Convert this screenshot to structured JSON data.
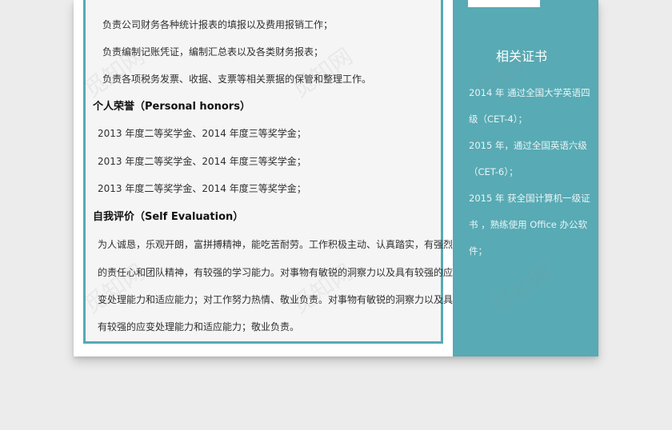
{
  "work_items": [
    "负责公司财务各种统计报表的填报以及费用报销工作；",
    "负责编制记账凭证，编制汇总表以及各类财务报表；",
    "负责各项税务发票、收据、支票等相关票据的保管和整理工作。"
  ],
  "honors": {
    "heading": "个人荣誉（Personal honors）",
    "items": [
      "2013 年度二等奖学金、2014 年度三等奖学金；",
      "2013 年度二等奖学金、2014 年度三等奖学金；",
      "2013 年度二等奖学金、2014 年度三等奖学金；"
    ]
  },
  "evaluation": {
    "heading": "自我评价（Self Evaluation）",
    "lines": [
      "为人诚恳，乐观开朗，富拼搏精神，能吃苦耐劳。工作积极主动、认真踏实，有强烈",
      "的责任心和团队精神，有较强的学习能力。对事物有敏锐的洞察力以及具有较强的应",
      "变处理能力和适应能力；对工作努力热情、敬业负责。对事物有敏锐的洞察力以及具",
      "有较强的应变处理能力和适应能力；敬业负责。"
    ]
  },
  "certificates": {
    "title": "相关证书",
    "lines": [
      "2014 年  通过全国大学英语四",
      "级（CET-4）；",
      "2015  年，通过全国英语六级",
      "（CET-6）；",
      "2015 年  获全国计算机一级证",
      "书  ，熟练使用  Office  办公软",
      "件；"
    ]
  },
  "watermark": "觅知网",
  "colors": {
    "accent": "#58aab4",
    "frame": "#56aab5",
    "background": "#ececec"
  }
}
